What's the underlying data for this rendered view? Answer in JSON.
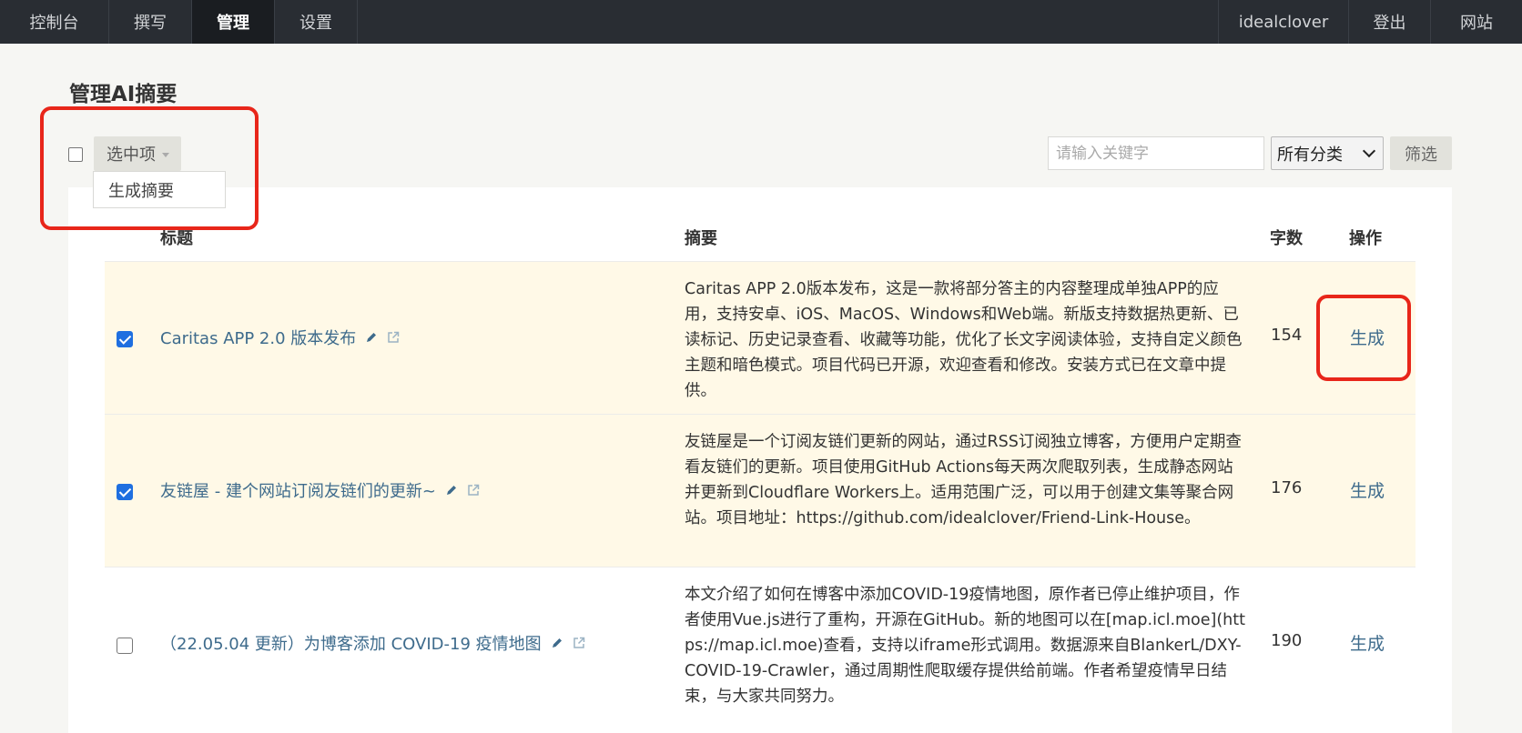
{
  "nav": {
    "left": [
      "控制台",
      "撰写",
      "管理",
      "设置"
    ],
    "active": "管理",
    "right": [
      "idealclover",
      "登出",
      "网站"
    ]
  },
  "page": {
    "title": "管理AI摘要"
  },
  "toolbar": {
    "batch_label": "选中项",
    "dropdown_item": "生成摘要",
    "search_placeholder": "请输入关键字",
    "category_selected": "所有分类",
    "filter_label": "筛选"
  },
  "table": {
    "headers": {
      "title": "标题",
      "summary": "摘要",
      "count": "字数",
      "action": "操作"
    },
    "rows": [
      {
        "checked": true,
        "title": "Caritas APP 2.0 版本发布",
        "summary": "Caritas APP 2.0版本发布，这是一款将部分答主的内容整理成单独APP的应用，支持安卓、iOS、MacOS、Windows和Web端。新版支持数据热更新、已读标记、历史记录查看、收藏等功能，优化了长文字阅读体验，支持自定义颜色主题和暗色模式。项目代码已开源，欢迎查看和修改。安装方式已在文章中提供。",
        "count": "154",
        "action": "生成"
      },
      {
        "checked": true,
        "title": "友链屋 - 建个网站订阅友链们的更新~",
        "summary": "友链屋是一个订阅友链们更新的网站，通过RSS订阅独立博客，方便用户定期查看友链们的更新。项目使用GitHub Actions每天两次爬取列表，生成静态网站并更新到Cloudflare Workers上。适用范围广泛，可以用于创建文集等聚合网站。项目地址：https://github.com/idealclover/Friend-Link-House。",
        "count": "176",
        "action": "生成"
      },
      {
        "checked": false,
        "title": "（22.05.04 更新）为博客添加 COVID-19 疫情地图",
        "summary": "本文介绍了如何在博客中添加COVID-19疫情地图，原作者已停止维护项目，作者使用Vue.js进行了重构，开源在GitHub。新的地图可以在[map.icl.moe](https://map.icl.moe)查看，支持以iframe形式调用。数据源来自BlankerL/DXY-COVID-19-Crawler，通过周期性爬取缓存提供给前端。作者希望疫情早日结束，与大家共同努力。",
        "count": "190",
        "action": "生成"
      }
    ]
  },
  "colors": {
    "nav_bg": "#292d33",
    "link": "#3e6b8c",
    "highlight": "#e8261a",
    "checked_row": "#fff9e7"
  }
}
